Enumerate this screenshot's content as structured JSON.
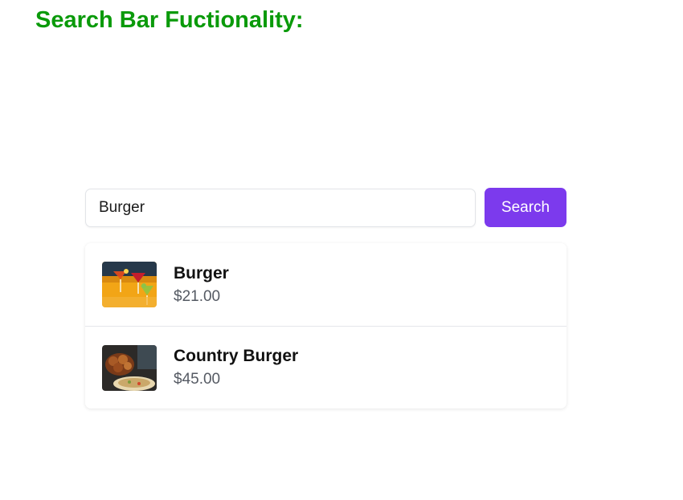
{
  "page": {
    "title": "Search Bar Fuctionality:"
  },
  "search": {
    "value": "Burger",
    "button_label": "Search"
  },
  "results": [
    {
      "name": "Burger",
      "price": "$21.00",
      "image": "cocktails-photo"
    },
    {
      "name": "Country Burger",
      "price": "$45.00",
      "image": "fried-food-photo"
    }
  ],
  "colors": {
    "title": "#0a9a0a",
    "accent": "#7c3aed",
    "price": "#555a63"
  }
}
